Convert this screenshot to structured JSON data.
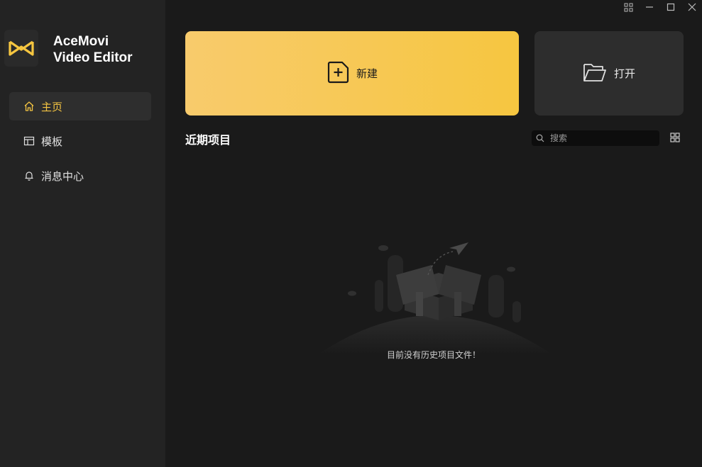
{
  "app": {
    "name_line1": "AceMovi",
    "name_line2": "Video Editor",
    "accent_color": "#f6c640"
  },
  "window_controls": [
    "apps-icon",
    "minimize-icon",
    "maximize-icon",
    "close-icon"
  ],
  "sidebar": {
    "items": [
      {
        "label": "主页",
        "icon": "home-icon",
        "active": true
      },
      {
        "label": "模板",
        "icon": "template-icon",
        "active": false
      },
      {
        "label": "消息中心",
        "icon": "bell-icon",
        "active": false
      }
    ]
  },
  "actions": {
    "new_label": "新建",
    "open_label": "打开"
  },
  "recent": {
    "title": "近期项目",
    "search_placeholder": "搜索",
    "empty_message": "目前没有历史项目文件！"
  }
}
